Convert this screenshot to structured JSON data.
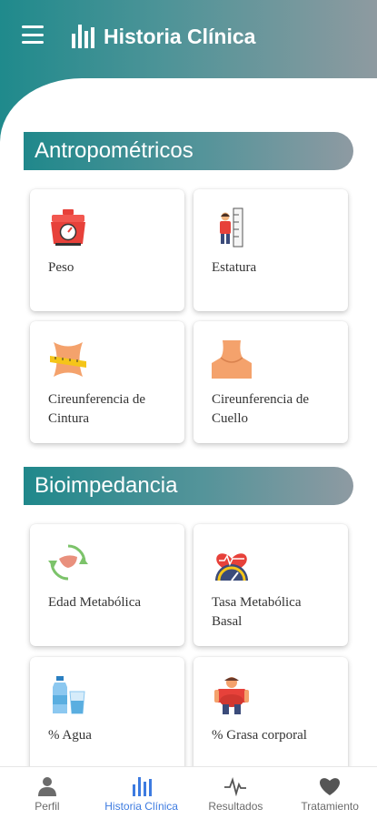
{
  "header": {
    "title": "Historia Clínica",
    "menu_icon": "hamburger-menu-icon",
    "logo_icon": "bar-chart-icon"
  },
  "sections": [
    {
      "title": "Antropométricos",
      "items": [
        {
          "label": "Peso",
          "icon": "scale-icon"
        },
        {
          "label": "Estatura",
          "icon": "height-measure-icon"
        },
        {
          "label": "Cireunferencia de\nCintura",
          "icon": "waist-tape-icon"
        },
        {
          "label": "Cireunferencia de\nCuello",
          "icon": "neck-icon"
        }
      ]
    },
    {
      "title": "Bioimpedancia",
      "items": [
        {
          "label": "Edad Metabólica",
          "icon": "liver-cycle-icon"
        },
        {
          "label": "Tasa Metabólica\nBasal",
          "icon": "heart-gauge-icon"
        },
        {
          "label": "% Agua",
          "icon": "water-bottle-icon"
        },
        {
          "label": "% Grasa corporal",
          "icon": "body-fat-icon"
        }
      ]
    }
  ],
  "bottom_nav": [
    {
      "label": "Perfil",
      "icon": "person-icon",
      "active": false
    },
    {
      "label": "Historia Clínica",
      "icon": "bar-chart-icon",
      "active": true
    },
    {
      "label": "Resultados",
      "icon": "pulse-icon",
      "active": false
    },
    {
      "label": "Tratamiento",
      "icon": "heart-icon",
      "active": false
    }
  ],
  "colors": {
    "header_gradient_start": "#1f8a8c",
    "header_gradient_end": "#8e9aa0",
    "active_nav": "#3d7be0"
  }
}
